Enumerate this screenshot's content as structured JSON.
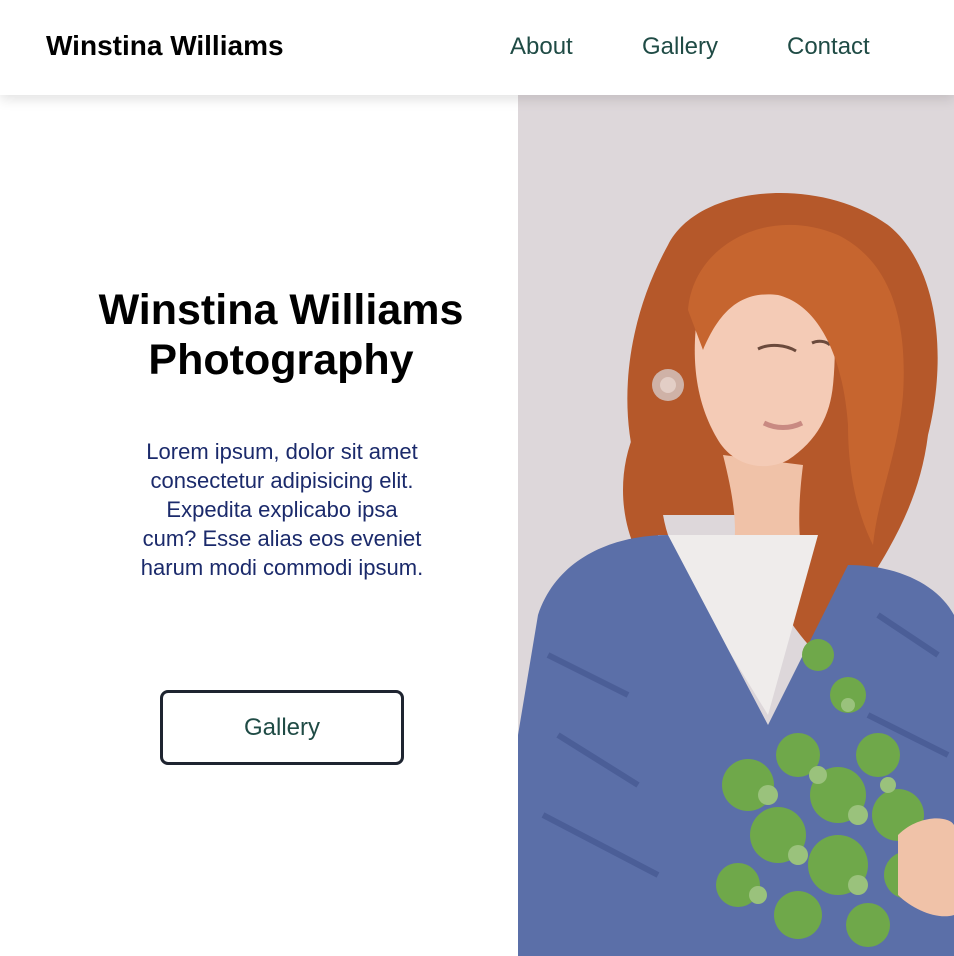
{
  "header": {
    "brand": "Winstina Williams",
    "nav": [
      {
        "label": "About"
      },
      {
        "label": "Gallery"
      },
      {
        "label": "Contact"
      }
    ]
  },
  "hero": {
    "title_line1": "Winstina Williams",
    "title_line2": "Photography",
    "text": "Lorem ipsum, dolor sit amet consectetur adipisicing elit. Expedita explicabo ipsa cum? Esse alias eos eveniet harum modi commodi ipsum.",
    "button_label": "Gallery"
  },
  "colors": {
    "nav_text": "#1f4b45",
    "body_text": "#1b2a6b",
    "photo_background": "#ddd7da"
  },
  "icons": [
    "portrait-photo"
  ]
}
